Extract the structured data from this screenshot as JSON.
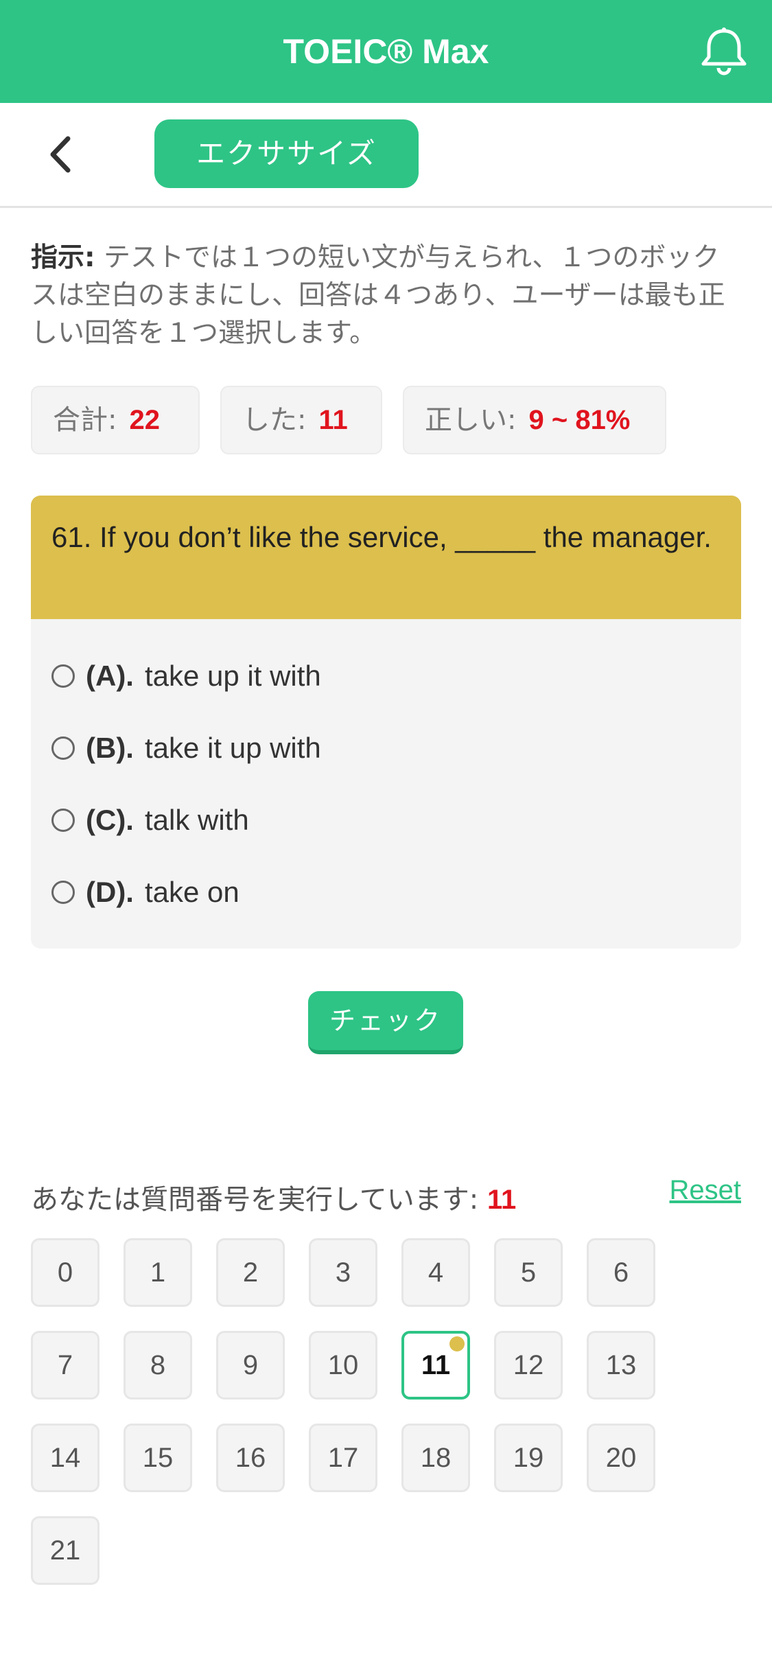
{
  "app": {
    "title": "TOEIC® Max"
  },
  "subnav": {
    "tab_label": "エクササイズ"
  },
  "instruction": {
    "label": "指示:",
    "text": " テストでは１つの短い文が与えられ、１つのボックスは空白のままにし、回答は４つあり、ユーザーは最も正しい回答を１つ選択します。"
  },
  "stats": {
    "total_label": "合計:",
    "total_value": "22",
    "done_label": "した:",
    "done_value": "11",
    "correct_label": "正しい:",
    "correct_value": "9 ~ 81%"
  },
  "question": {
    "text": "61. If you don’t like the service, _____ the manager.",
    "options": [
      {
        "letter": "(A).",
        "text": "take up it with"
      },
      {
        "letter": "(B).",
        "text": "take it up with"
      },
      {
        "letter": "(C).",
        "text": "talk with"
      },
      {
        "letter": "(D).",
        "text": "take on"
      }
    ]
  },
  "check_label": "チェック",
  "progress": {
    "label": "あなたは質問番号を実行しています: ",
    "current": "11",
    "reset_label": "Reset"
  },
  "question_numbers": [
    "0",
    "1",
    "2",
    "3",
    "4",
    "5",
    "6",
    "7",
    "8",
    "9",
    "10",
    "11",
    "12",
    "13",
    "14",
    "15",
    "16",
    "17",
    "18",
    "19",
    "20",
    "21"
  ],
  "current_index": 11,
  "colors": {
    "accent": "#2ec486",
    "question_bg": "#dcbf4d",
    "highlight": "#e0141e"
  },
  "icons": {
    "notification": "bell-icon",
    "back": "chevron-left-icon"
  }
}
